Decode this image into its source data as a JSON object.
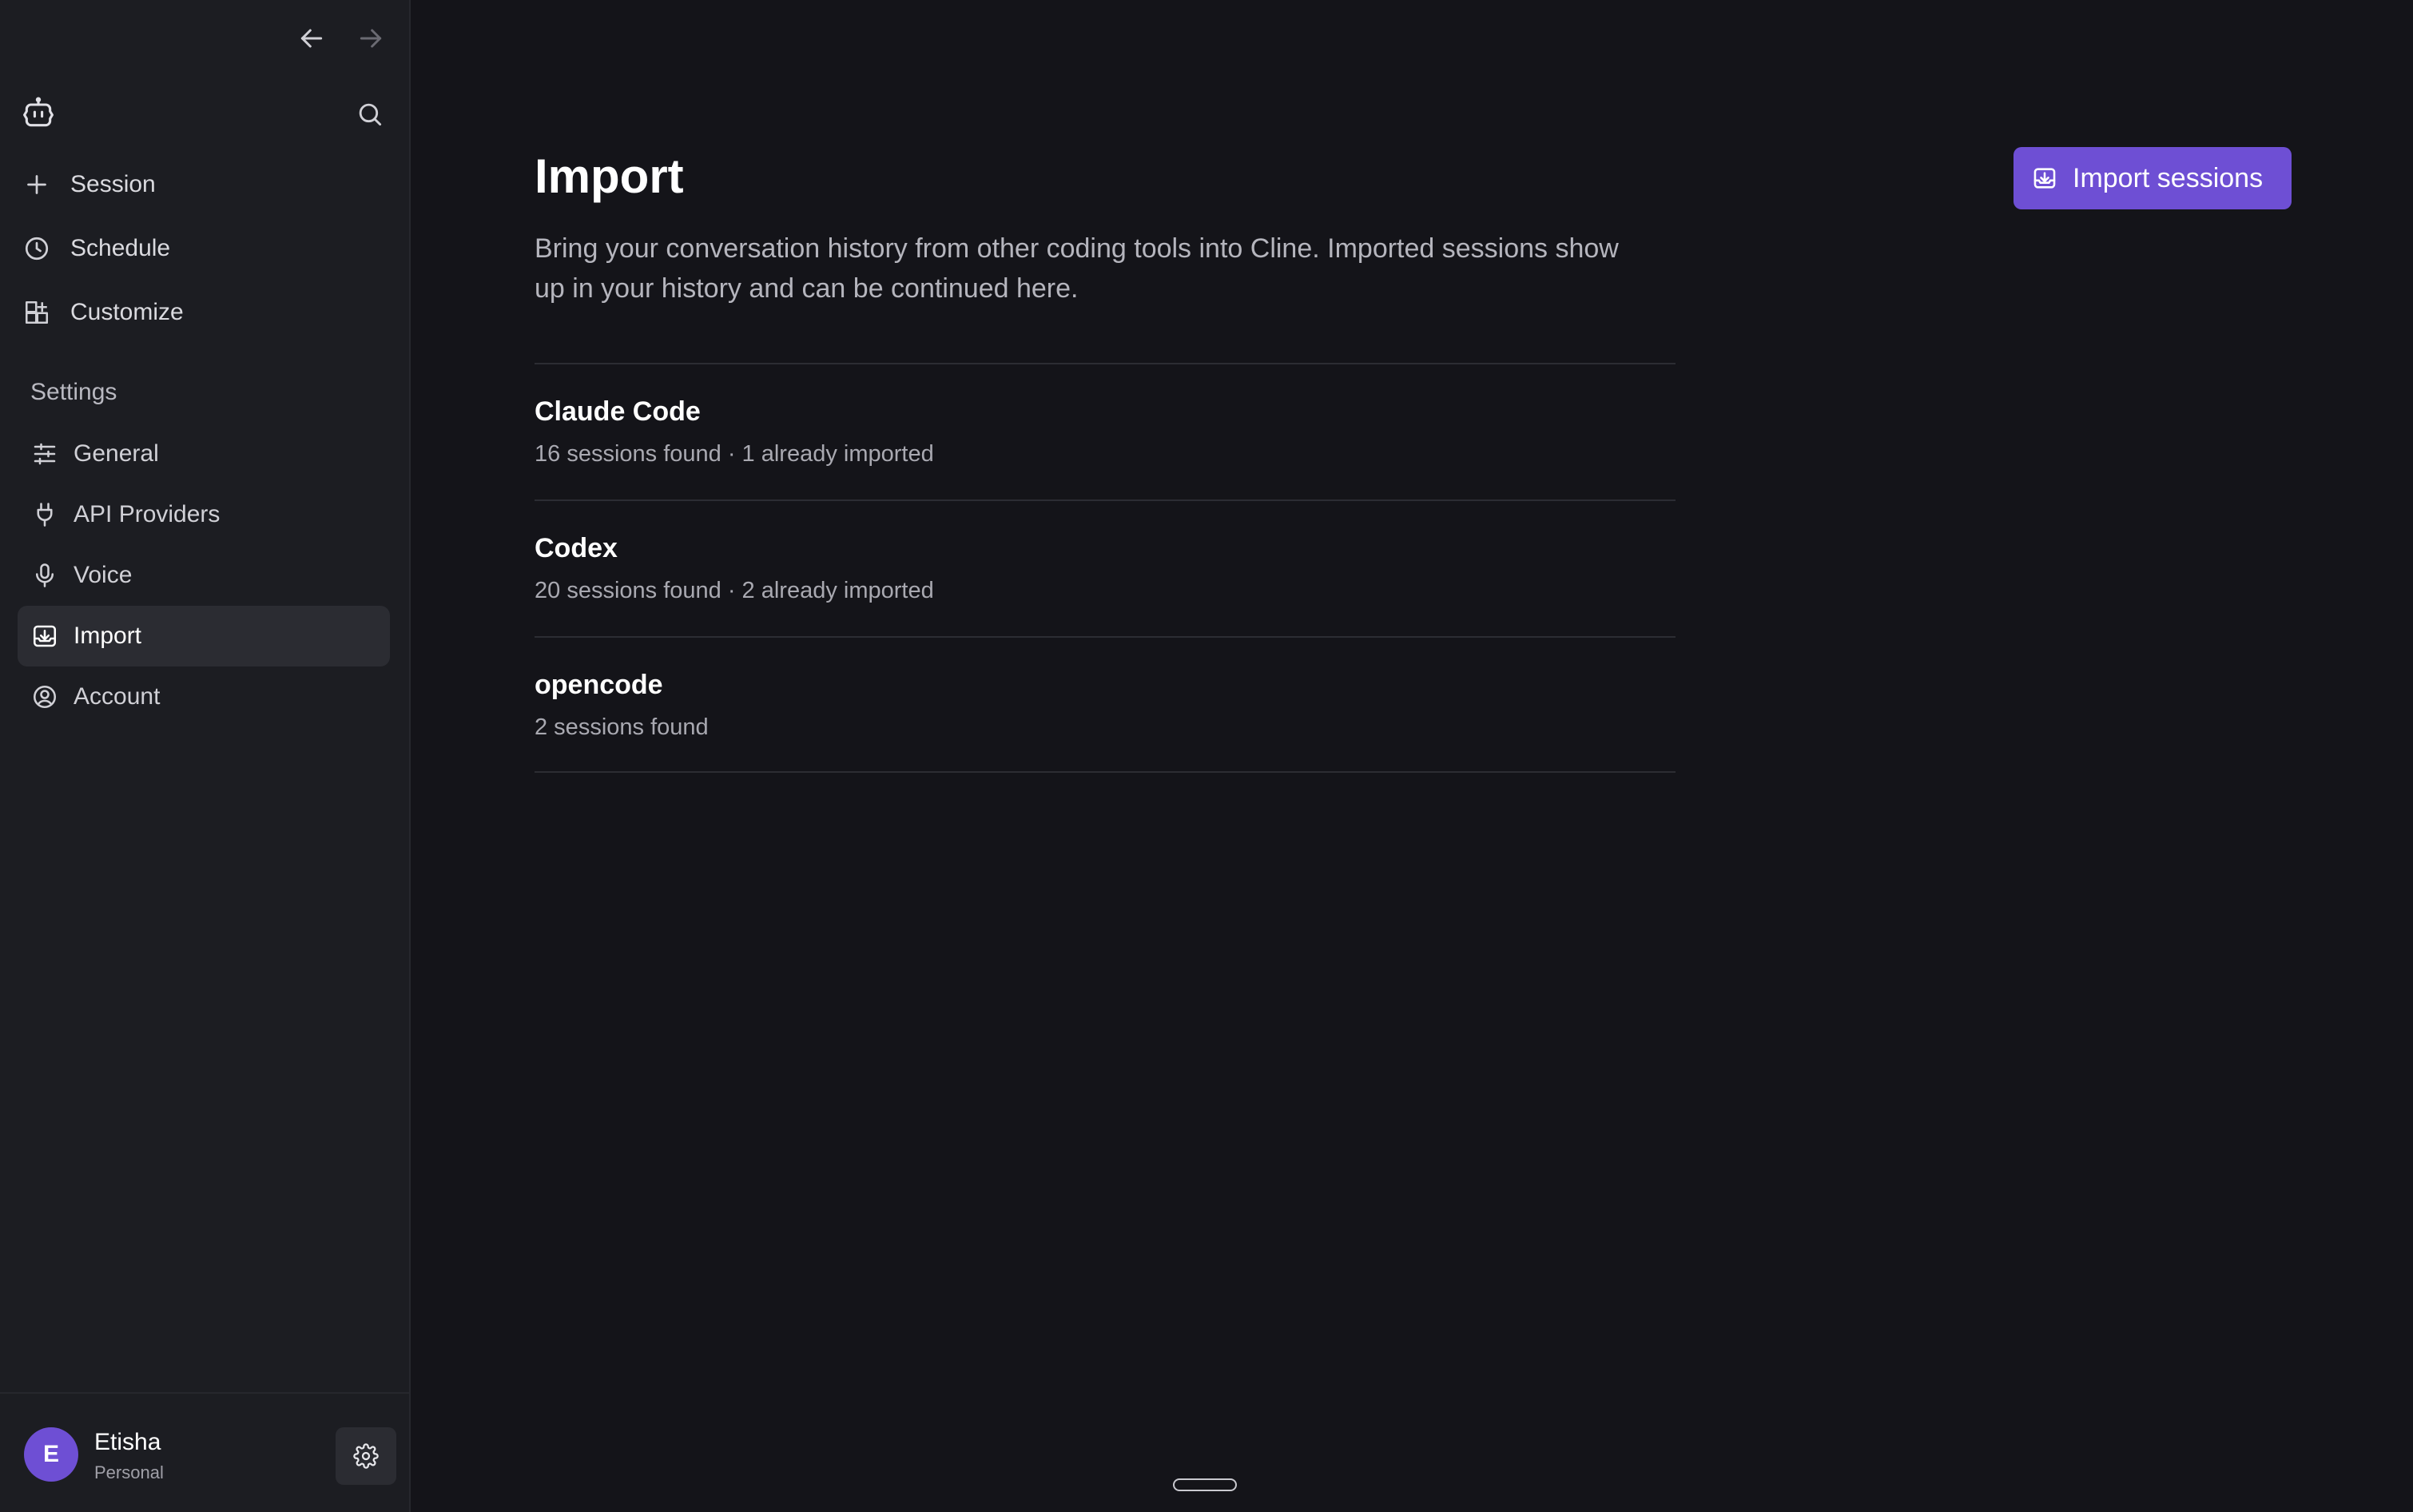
{
  "sidebar": {
    "top_items": [
      {
        "label": "Session",
        "icon": "plus-icon"
      },
      {
        "label": "Schedule",
        "icon": "clock-icon"
      },
      {
        "label": "Customize",
        "icon": "grid-plus-icon"
      }
    ],
    "settings_title": "Settings",
    "settings_items": [
      {
        "label": "General",
        "icon": "sliders-icon"
      },
      {
        "label": "API Providers",
        "icon": "plug-icon"
      },
      {
        "label": "Voice",
        "icon": "microphone-icon"
      },
      {
        "label": "Import",
        "icon": "download-tray-icon",
        "active": true
      },
      {
        "label": "Account",
        "icon": "user-circle-icon"
      }
    ],
    "user": {
      "initial": "E",
      "name": "Etisha",
      "plan": "Personal"
    }
  },
  "main": {
    "title": "Import",
    "description": "Bring your conversation history from other coding tools into Cline. Imported sessions show up in your history and can be continued here.",
    "import_button_label": "Import sessions",
    "sources": [
      {
        "name": "Claude Code",
        "status": "16 sessions found · 1 already imported"
      },
      {
        "name": "Codex",
        "status": "20 sessions found · 2 already imported"
      },
      {
        "name": "opencode",
        "status": "2 sessions found"
      }
    ]
  },
  "colors": {
    "accent": "#6e4fd4",
    "background": "#141419",
    "sidebar": "#1c1d22"
  }
}
